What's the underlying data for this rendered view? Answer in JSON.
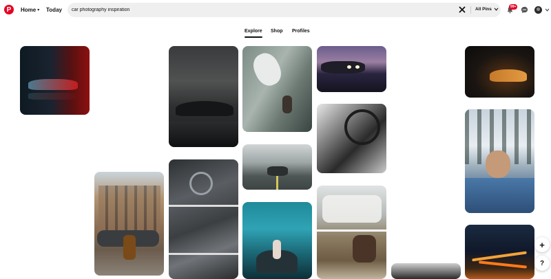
{
  "header": {
    "logo_letter": "P",
    "nav": {
      "home": "Home",
      "today": "Today"
    },
    "search": {
      "value": "car photography inspiration",
      "placeholder": "Search"
    },
    "filter": {
      "label": "All Pins"
    },
    "notifications": {
      "badge": "99+"
    }
  },
  "tabs": [
    {
      "label": "Explore",
      "active": true
    },
    {
      "label": "Shop",
      "active": false
    },
    {
      "label": "Profiles",
      "active": false
    }
  ],
  "pins": [
    {
      "name": "red-sports-car-reflection"
    },
    {
      "name": "woman-sitting-by-classic-car-street"
    },
    {
      "name": "porsche-in-dark-garage"
    },
    {
      "name": "aerial-white-roadster"
    },
    {
      "name": "mercedes-grille-closeup"
    },
    {
      "name": "car-on-forest-road"
    },
    {
      "name": "woman-on-car-blue-smoke"
    },
    {
      "name": "classic-car-night-reflection"
    },
    {
      "name": "vintage-steering-wheel-bw"
    },
    {
      "name": "classic-car-interior-couple"
    },
    {
      "name": "dark-car-partial"
    },
    {
      "name": "orange-sports-car-dark"
    },
    {
      "name": "woman-in-car-snowy-forest"
    },
    {
      "name": "light-trails-night-road"
    }
  ],
  "fab": {
    "add": "+",
    "help": "?"
  },
  "colors": {
    "brand": "#e60023",
    "search_bg": "#efefef",
    "text": "#111111"
  }
}
